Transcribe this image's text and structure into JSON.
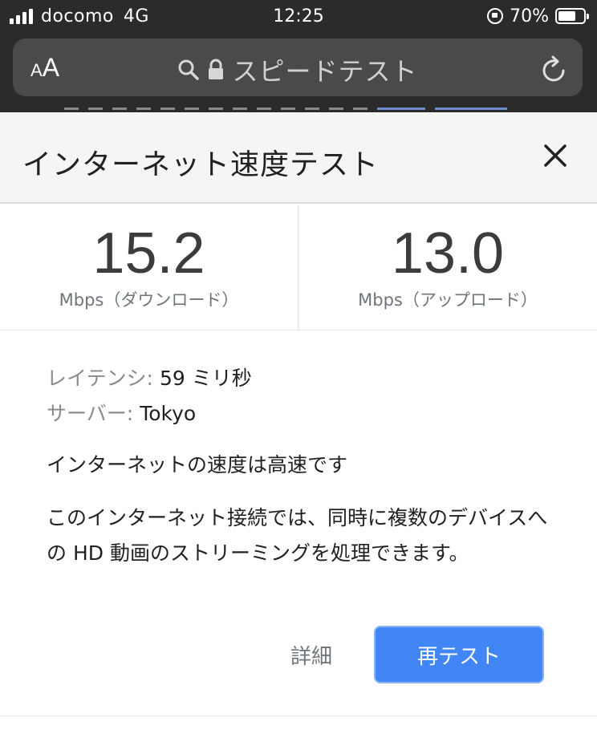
{
  "status_bar": {
    "carrier": "docomo",
    "network": "4G",
    "time": "12:25",
    "battery_percent": "70%",
    "battery_level": 0.7
  },
  "browser": {
    "text_size_small": "A",
    "text_size_large": "A",
    "page_title": "スピードテスト",
    "icons": [
      "search-icon",
      "lock-icon",
      "reload-icon"
    ]
  },
  "card": {
    "title": "インターネット速度テスト",
    "download": {
      "value": "15.2",
      "unit": "Mbps（ダウンロード）"
    },
    "upload": {
      "value": "13.0",
      "unit": "Mbps（アップロード）"
    },
    "latency_label": "レイテンシ:",
    "latency_value": "59 ミリ秒",
    "server_label": "サーバー:",
    "server_value": "Tokyo",
    "verdict": "インターネットの速度は高速です",
    "description": "このインターネット接続では、同時に複数のデバイスへの HD 動画のストリーミングを処理できます。",
    "details_label": "詳細",
    "retest_label": "再テスト"
  },
  "colors": {
    "accent": "#4285f4",
    "header_bg": "#f5f5f5",
    "browser_chrome": "#2b2b2b"
  }
}
